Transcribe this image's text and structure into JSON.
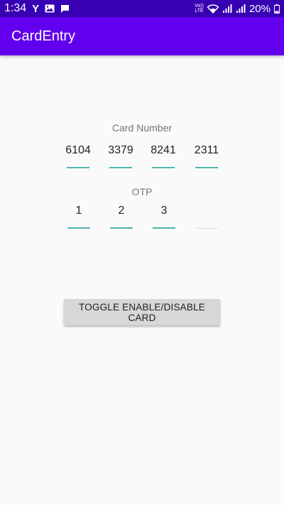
{
  "status_bar": {
    "time": "1:34",
    "carrier_icon": "Y",
    "lte_top": "Vo))",
    "lte_bottom": "LTE",
    "battery_percent": "20%",
    "icons": [
      "image-icon",
      "message-icon",
      "wifi-icon",
      "signal-icon",
      "battery-icon"
    ]
  },
  "app_bar": {
    "title": "CardEntry"
  },
  "card_section": {
    "label": "Card Number",
    "digits": [
      "6104",
      "3379",
      "8241",
      "2311"
    ]
  },
  "otp_section": {
    "label": "OTP",
    "digits": [
      "1",
      "2",
      "3",
      ""
    ]
  },
  "toggle_button": {
    "label": "TOGGLE ENABLE/DISABLE CARD"
  },
  "colors": {
    "status_bar": "#3700b3",
    "app_bar": "#6200ee",
    "underline": "#4db6ac",
    "button": "#d6d7d7"
  }
}
